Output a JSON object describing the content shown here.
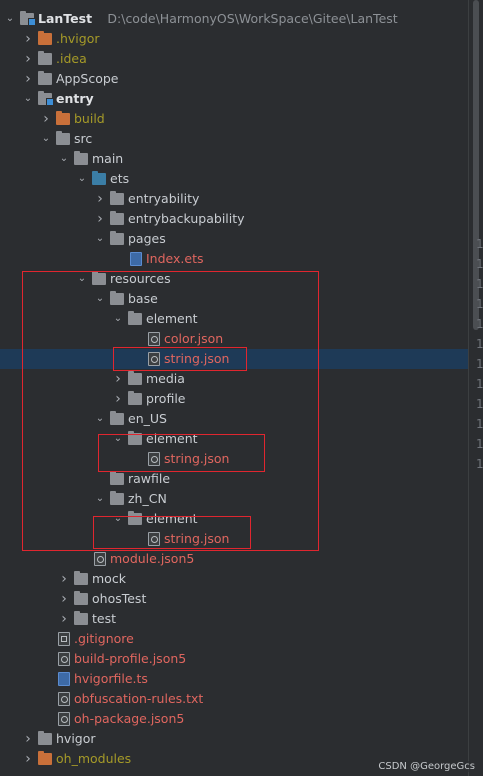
{
  "rows": [
    {
      "indent": 0,
      "arrow": "down",
      "icon": "module",
      "label": "LanTest",
      "color": "root",
      "path": "D:\\code\\HarmonyOS\\WorkSpace\\Gitee\\LanTest",
      "name": "project-root-lantest"
    },
    {
      "indent": 1,
      "arrow": "right",
      "icon": "folder-orange",
      "label": ".hvigor",
      "color": "olive",
      "name": "folder-hvigor-cache"
    },
    {
      "indent": 1,
      "arrow": "right",
      "icon": "folder",
      "label": ".idea",
      "color": "olive",
      "name": "folder-idea"
    },
    {
      "indent": 1,
      "arrow": "right",
      "icon": "folder",
      "label": "AppScope",
      "color": "norm",
      "name": "folder-appscope"
    },
    {
      "indent": 1,
      "arrow": "down",
      "icon": "module",
      "label": "entry",
      "color": "root",
      "name": "folder-entry"
    },
    {
      "indent": 2,
      "arrow": "right",
      "icon": "folder-orange",
      "label": "build",
      "color": "olive",
      "name": "folder-build"
    },
    {
      "indent": 2,
      "arrow": "down",
      "icon": "folder",
      "label": "src",
      "color": "norm",
      "name": "folder-src"
    },
    {
      "indent": 3,
      "arrow": "down",
      "icon": "folder",
      "label": "main",
      "color": "norm",
      "name": "folder-main"
    },
    {
      "indent": 4,
      "arrow": "down",
      "icon": "folder-blue",
      "label": "ets",
      "color": "norm",
      "name": "folder-ets"
    },
    {
      "indent": 5,
      "arrow": "right",
      "icon": "folder",
      "label": "entryability",
      "color": "norm",
      "name": "folder-entryability"
    },
    {
      "indent": 5,
      "arrow": "right",
      "icon": "folder",
      "label": "entrybackupability",
      "color": "norm",
      "name": "folder-entrybackupability"
    },
    {
      "indent": 5,
      "arrow": "down",
      "icon": "folder",
      "label": "pages",
      "color": "norm",
      "name": "folder-pages"
    },
    {
      "indent": 6,
      "arrow": "none",
      "icon": "file-ets",
      "label": "Index.ets",
      "color": "red",
      "name": "file-index-ets"
    },
    {
      "indent": 4,
      "arrow": "down",
      "icon": "folder",
      "label": "resources",
      "color": "norm",
      "name": "folder-resources"
    },
    {
      "indent": 5,
      "arrow": "down",
      "icon": "folder",
      "label": "base",
      "color": "norm",
      "name": "folder-base"
    },
    {
      "indent": 6,
      "arrow": "down",
      "icon": "folder",
      "label": "element",
      "color": "norm",
      "name": "folder-base-element"
    },
    {
      "indent": 7,
      "arrow": "none",
      "icon": "file-json",
      "label": "color.json",
      "color": "red",
      "name": "file-color-json"
    },
    {
      "indent": 7,
      "arrow": "none",
      "icon": "file-json",
      "label": "string.json",
      "color": "red",
      "name": "file-base-string-json",
      "selected": true
    },
    {
      "indent": 6,
      "arrow": "right",
      "icon": "folder",
      "label": "media",
      "color": "norm",
      "name": "folder-media"
    },
    {
      "indent": 6,
      "arrow": "right",
      "icon": "folder",
      "label": "profile",
      "color": "norm",
      "name": "folder-profile"
    },
    {
      "indent": 5,
      "arrow": "down",
      "icon": "folder",
      "label": "en_US",
      "color": "norm",
      "name": "folder-en-us"
    },
    {
      "indent": 6,
      "arrow": "down",
      "icon": "folder",
      "label": "element",
      "color": "norm",
      "name": "folder-en-us-element"
    },
    {
      "indent": 7,
      "arrow": "none",
      "icon": "file-json",
      "label": "string.json",
      "color": "red",
      "name": "file-en-us-string-json"
    },
    {
      "indent": 5,
      "arrow": "none",
      "icon": "folder",
      "label": "rawfile",
      "color": "norm",
      "name": "folder-rawfile"
    },
    {
      "indent": 5,
      "arrow": "down",
      "icon": "folder",
      "label": "zh_CN",
      "color": "norm",
      "name": "folder-zh-cn"
    },
    {
      "indent": 6,
      "arrow": "down",
      "icon": "folder",
      "label": "element",
      "color": "norm",
      "name": "folder-zh-cn-element"
    },
    {
      "indent": 7,
      "arrow": "none",
      "icon": "file-json",
      "label": "string.json",
      "color": "red",
      "name": "file-zh-cn-string-json"
    },
    {
      "indent": 4,
      "arrow": "none",
      "icon": "file-json",
      "label": "module.json5",
      "color": "red",
      "name": "file-module-json5"
    },
    {
      "indent": 3,
      "arrow": "right",
      "icon": "folder",
      "label": "mock",
      "color": "norm",
      "name": "folder-mock"
    },
    {
      "indent": 3,
      "arrow": "right",
      "icon": "folder",
      "label": "ohosTest",
      "color": "norm",
      "name": "folder-ohostest"
    },
    {
      "indent": 3,
      "arrow": "right",
      "icon": "folder",
      "label": "test",
      "color": "norm",
      "name": "folder-test"
    },
    {
      "indent": 2,
      "arrow": "none",
      "icon": "file-git",
      "label": ".gitignore",
      "color": "red",
      "name": "file-gitignore"
    },
    {
      "indent": 2,
      "arrow": "none",
      "icon": "file-json",
      "label": "build-profile.json5",
      "color": "red",
      "name": "file-build-profile-json5"
    },
    {
      "indent": 2,
      "arrow": "none",
      "icon": "file-ts",
      "label": "hvigorfile.ts",
      "color": "red",
      "name": "file-hvigorfile-ts"
    },
    {
      "indent": 2,
      "arrow": "none",
      "icon": "file-txt",
      "label": "obfuscation-rules.txt",
      "color": "red",
      "name": "file-obfuscation-rules-txt"
    },
    {
      "indent": 2,
      "arrow": "none",
      "icon": "file-json",
      "label": "oh-package.json5",
      "color": "red",
      "name": "file-oh-package-json5"
    },
    {
      "indent": 1,
      "arrow": "right",
      "icon": "folder",
      "label": "hvigor",
      "color": "norm",
      "name": "folder-hvigor"
    },
    {
      "indent": 1,
      "arrow": "right",
      "icon": "folder-orange",
      "label": "oh_modules",
      "color": "olive",
      "name": "folder-oh-modules"
    }
  ],
  "gutter_numbers": [
    "1",
    "1",
    "1",
    "1",
    "1",
    "1",
    "1",
    "1",
    "1",
    "1",
    "1",
    "1"
  ],
  "watermark": "CSDN @GeorgeGcs",
  "colors": {
    "highlight_box": "#e0262f",
    "selection": "#1e3a57"
  }
}
